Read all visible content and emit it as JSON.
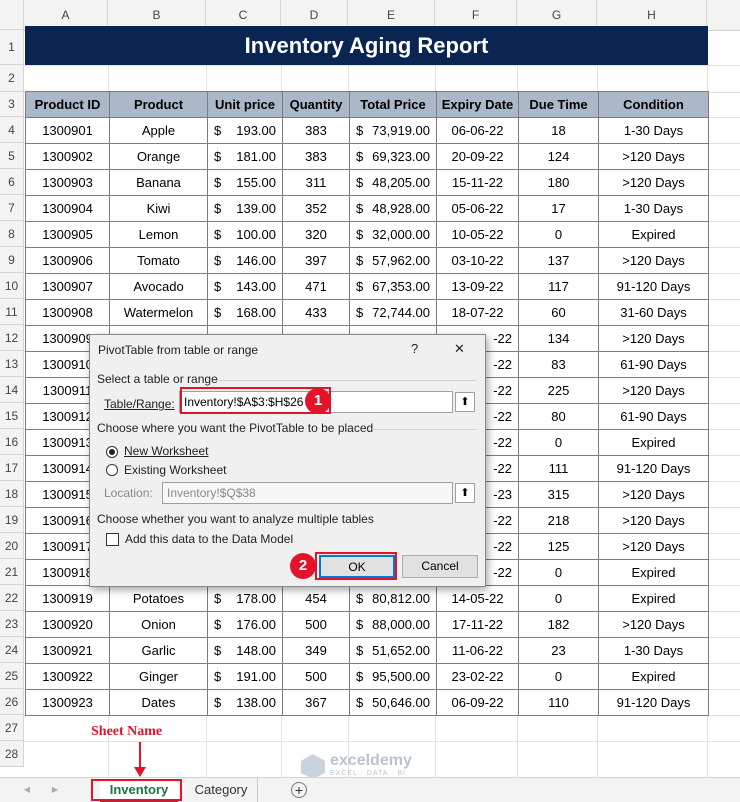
{
  "columns": [
    "A",
    "B",
    "C",
    "D",
    "E",
    "F",
    "G",
    "H"
  ],
  "rows": [
    "1",
    "2",
    "3",
    "4",
    "5",
    "6",
    "7",
    "8",
    "9",
    "10",
    "11",
    "12",
    "13",
    "14",
    "15",
    "16",
    "17",
    "18",
    "19",
    "20",
    "21",
    "22",
    "23",
    "24",
    "25",
    "26",
    "27",
    "28"
  ],
  "title": "Inventory Aging Report",
  "headers": [
    "Product ID",
    "Product",
    "Unit price",
    "Quantity",
    "Total Price",
    "Expiry Date",
    "Due Time",
    "Condition"
  ],
  "records": [
    [
      "1300901",
      "Apple",
      "193.00",
      "383",
      "73,919.00",
      "06-06-22",
      "18",
      "1-30 Days"
    ],
    [
      "1300902",
      "Orange",
      "181.00",
      "383",
      "69,323.00",
      "20-09-22",
      "124",
      ">120 Days"
    ],
    [
      "1300903",
      "Banana",
      "155.00",
      "311",
      "48,205.00",
      "15-11-22",
      "180",
      ">120 Days"
    ],
    [
      "1300904",
      "Kiwi",
      "139.00",
      "352",
      "48,928.00",
      "05-06-22",
      "17",
      "1-30 Days"
    ],
    [
      "1300905",
      "Lemon",
      "100.00",
      "320",
      "32,000.00",
      "10-05-22",
      "0",
      "Expired"
    ],
    [
      "1300906",
      "Tomato",
      "146.00",
      "397",
      "57,962.00",
      "03-10-22",
      "137",
      ">120 Days"
    ],
    [
      "1300907",
      "Avocado",
      "143.00",
      "471",
      "67,353.00",
      "13-09-22",
      "117",
      "91-120 Days"
    ],
    [
      "1300908",
      "Watermelon",
      "168.00",
      "433",
      "72,744.00",
      "18-07-22",
      "60",
      "31-60 Days"
    ],
    [
      "1300909",
      "",
      "",
      "",
      "",
      "-22",
      "134",
      ">120 Days"
    ],
    [
      "1300910",
      "",
      "",
      "",
      "",
      "-22",
      "83",
      "61-90 Days"
    ],
    [
      "1300911",
      "",
      "",
      "",
      "",
      "-22",
      "225",
      ">120 Days"
    ],
    [
      "1300912",
      "",
      "",
      "",
      "",
      "-22",
      "80",
      "61-90 Days"
    ],
    [
      "1300913",
      "",
      "",
      "",
      "",
      "-22",
      "0",
      "Expired"
    ],
    [
      "1300914",
      "",
      "",
      "",
      "",
      "-22",
      "111",
      "91-120 Days"
    ],
    [
      "1300915",
      "",
      "",
      "",
      "",
      "-23",
      "315",
      ">120 Days"
    ],
    [
      "1300916",
      "",
      "",
      "",
      "",
      "-22",
      "218",
      ">120 Days"
    ],
    [
      "1300917",
      "",
      "",
      "",
      "",
      "-22",
      "125",
      ">120 Days"
    ],
    [
      "1300918",
      "",
      "",
      "",
      "",
      "-22",
      "0",
      "Expired"
    ],
    [
      "1300919",
      "Potatoes",
      "178.00",
      "454",
      "80,812.00",
      "14-05-22",
      "0",
      "Expired"
    ],
    [
      "1300920",
      "Onion",
      "176.00",
      "500",
      "88,000.00",
      "17-11-22",
      "182",
      ">120 Days"
    ],
    [
      "1300921",
      "Garlic",
      "148.00",
      "349",
      "51,652.00",
      "11-06-22",
      "23",
      "1-30 Days"
    ],
    [
      "1300922",
      "Ginger",
      "191.00",
      "500",
      "95,500.00",
      "23-02-22",
      "0",
      "Expired"
    ],
    [
      "1300923",
      "Dates",
      "138.00",
      "367",
      "50,646.00",
      "06-09-22",
      "110",
      "91-120 Days"
    ]
  ],
  "currency_symbol": "$",
  "dialog": {
    "title": "PivotTable from table or range",
    "help": "?",
    "close": "✕",
    "select_label": "Select a table or range",
    "table_range_label": "Table/Range:",
    "table_range_value": "Inventory!$A$3:$H$26",
    "placement_label": "Choose where you want the PivotTable to be placed",
    "new_ws": "New Worksheet",
    "existing_ws": "Existing Worksheet",
    "location_label": "Location:",
    "location_value": "Inventory!$Q$38",
    "multi_label": "Choose whether you want to analyze multiple tables",
    "data_model_label": "Add this data to the Data Model",
    "ok": "OK",
    "cancel": "Cancel",
    "badge1": "1",
    "badge2": "2"
  },
  "annotation": {
    "sheet_name": "Sheet Name"
  },
  "tabs": {
    "active": "Inventory",
    "other": "Category",
    "add": "+",
    "prev": "◀",
    "next": "▶"
  },
  "watermark": {
    "name": "exceldemy",
    "tagline": "EXCEL · DATA · BI"
  },
  "colors": {
    "banner": "#0b2553",
    "header_fill": "#aab8c9",
    "highlight": "#e3132a",
    "active_tab_text": "#1e7145"
  }
}
